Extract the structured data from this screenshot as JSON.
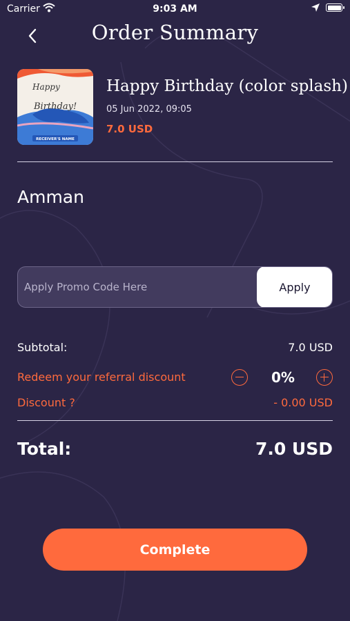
{
  "status_bar": {
    "carrier": "Carrier",
    "time": "9:03 AM"
  },
  "header": {
    "title": "Order Summary"
  },
  "product": {
    "name": "Happy Birthday (color splash)",
    "date": "05 Jun 2022, 09:05",
    "price": "7.0 USD",
    "card_text": {
      "line1": "Happy",
      "line2": "Birthday!",
      "banner": "RECEIVER'S NAME"
    }
  },
  "city": "Amman",
  "promo": {
    "placeholder": "Apply Promo Code Here",
    "value": "",
    "apply_label": "Apply"
  },
  "summary": {
    "subtotal_label": "Subtotal:",
    "subtotal_value": "7.0 USD",
    "referral_label": "Redeem your referral discount",
    "referral_percent": "0%",
    "discount_label": "Discount ?",
    "discount_value": "- 0.00 USD",
    "total_label": "Total:",
    "total_value": "7.0 USD"
  },
  "complete_label": "Complete",
  "colors": {
    "background": "#2b2546",
    "accent": "#ff6a3d",
    "text": "#ffffff",
    "divider": "#d8d4e6"
  },
  "icons": [
    "wifi-icon",
    "location-arrow-icon",
    "battery-icon",
    "back-chevron-icon",
    "minus-circle-icon",
    "plus-circle-icon"
  ]
}
